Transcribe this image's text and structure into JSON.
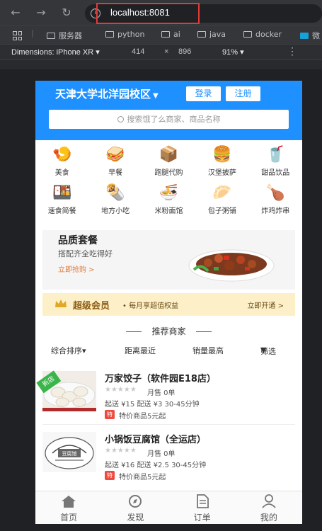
{
  "browser": {
    "url": "localhost:8081",
    "bookmarks": [
      "服务器",
      "python",
      "ai",
      "java",
      "docker",
      "微"
    ],
    "device": "Dimensions: iPhone XR",
    "width": "414",
    "times": "×",
    "height": "896",
    "zoom": "91%"
  },
  "header": {
    "campus": "天津大学北洋园校区",
    "login": "登录",
    "register": "注册",
    "search_placeholder": "搜索饿了么商家、商品名称"
  },
  "categories": [
    {
      "label": "美食",
      "icon": "🍤"
    },
    {
      "label": "早餐",
      "icon": "🥪"
    },
    {
      "label": "跑腿代购",
      "icon": "📦"
    },
    {
      "label": "汉堡披萨",
      "icon": "🍔"
    },
    {
      "label": "甜品饮品",
      "icon": "🥤"
    },
    {
      "label": "速食简餐",
      "icon": "🍱"
    },
    {
      "label": "地方小吃",
      "icon": "🌯"
    },
    {
      "label": "米粉面馆",
      "icon": "🍜"
    },
    {
      "label": "包子粥铺",
      "icon": "🥟"
    },
    {
      "label": "炸鸡炸串",
      "icon": "🍗"
    }
  ],
  "quality": {
    "title": "品质套餐",
    "subtitle": "搭配齐全吃得好",
    "link": "立即抢购 >"
  },
  "vip": {
    "title": "超级会员",
    "desc": "• 每月享超值权益",
    "link": "立即开通 >"
  },
  "recommend": {
    "title": "推荐商家",
    "sort": [
      "综合排序▾",
      "距离最近",
      "销量最高",
      "筛选"
    ]
  },
  "shops": [
    {
      "name": "万家饺子（软件园E18店）",
      "stars": "★★★★★",
      "sales": "月售 0单",
      "delivery": "起送 ¥15   配送 ¥3   30-45分钟",
      "badge": "特",
      "promo": "特价商品5元起",
      "tag": "新店"
    },
    {
      "name": "小锅饭豆腐馆（全运店）",
      "stars": "★★★★★",
      "sales": "月售 0单",
      "delivery": "起送 ¥16   配送 ¥2.5   30-45分钟",
      "badge": "特",
      "promo": "特价商品5元起"
    }
  ],
  "tabs": [
    "首页",
    "发现",
    "订单",
    "我的"
  ],
  "colors": {
    "primary": "#1e90ff",
    "vip_bg": "#fdf0c9",
    "promo": "#ef4a3d"
  }
}
